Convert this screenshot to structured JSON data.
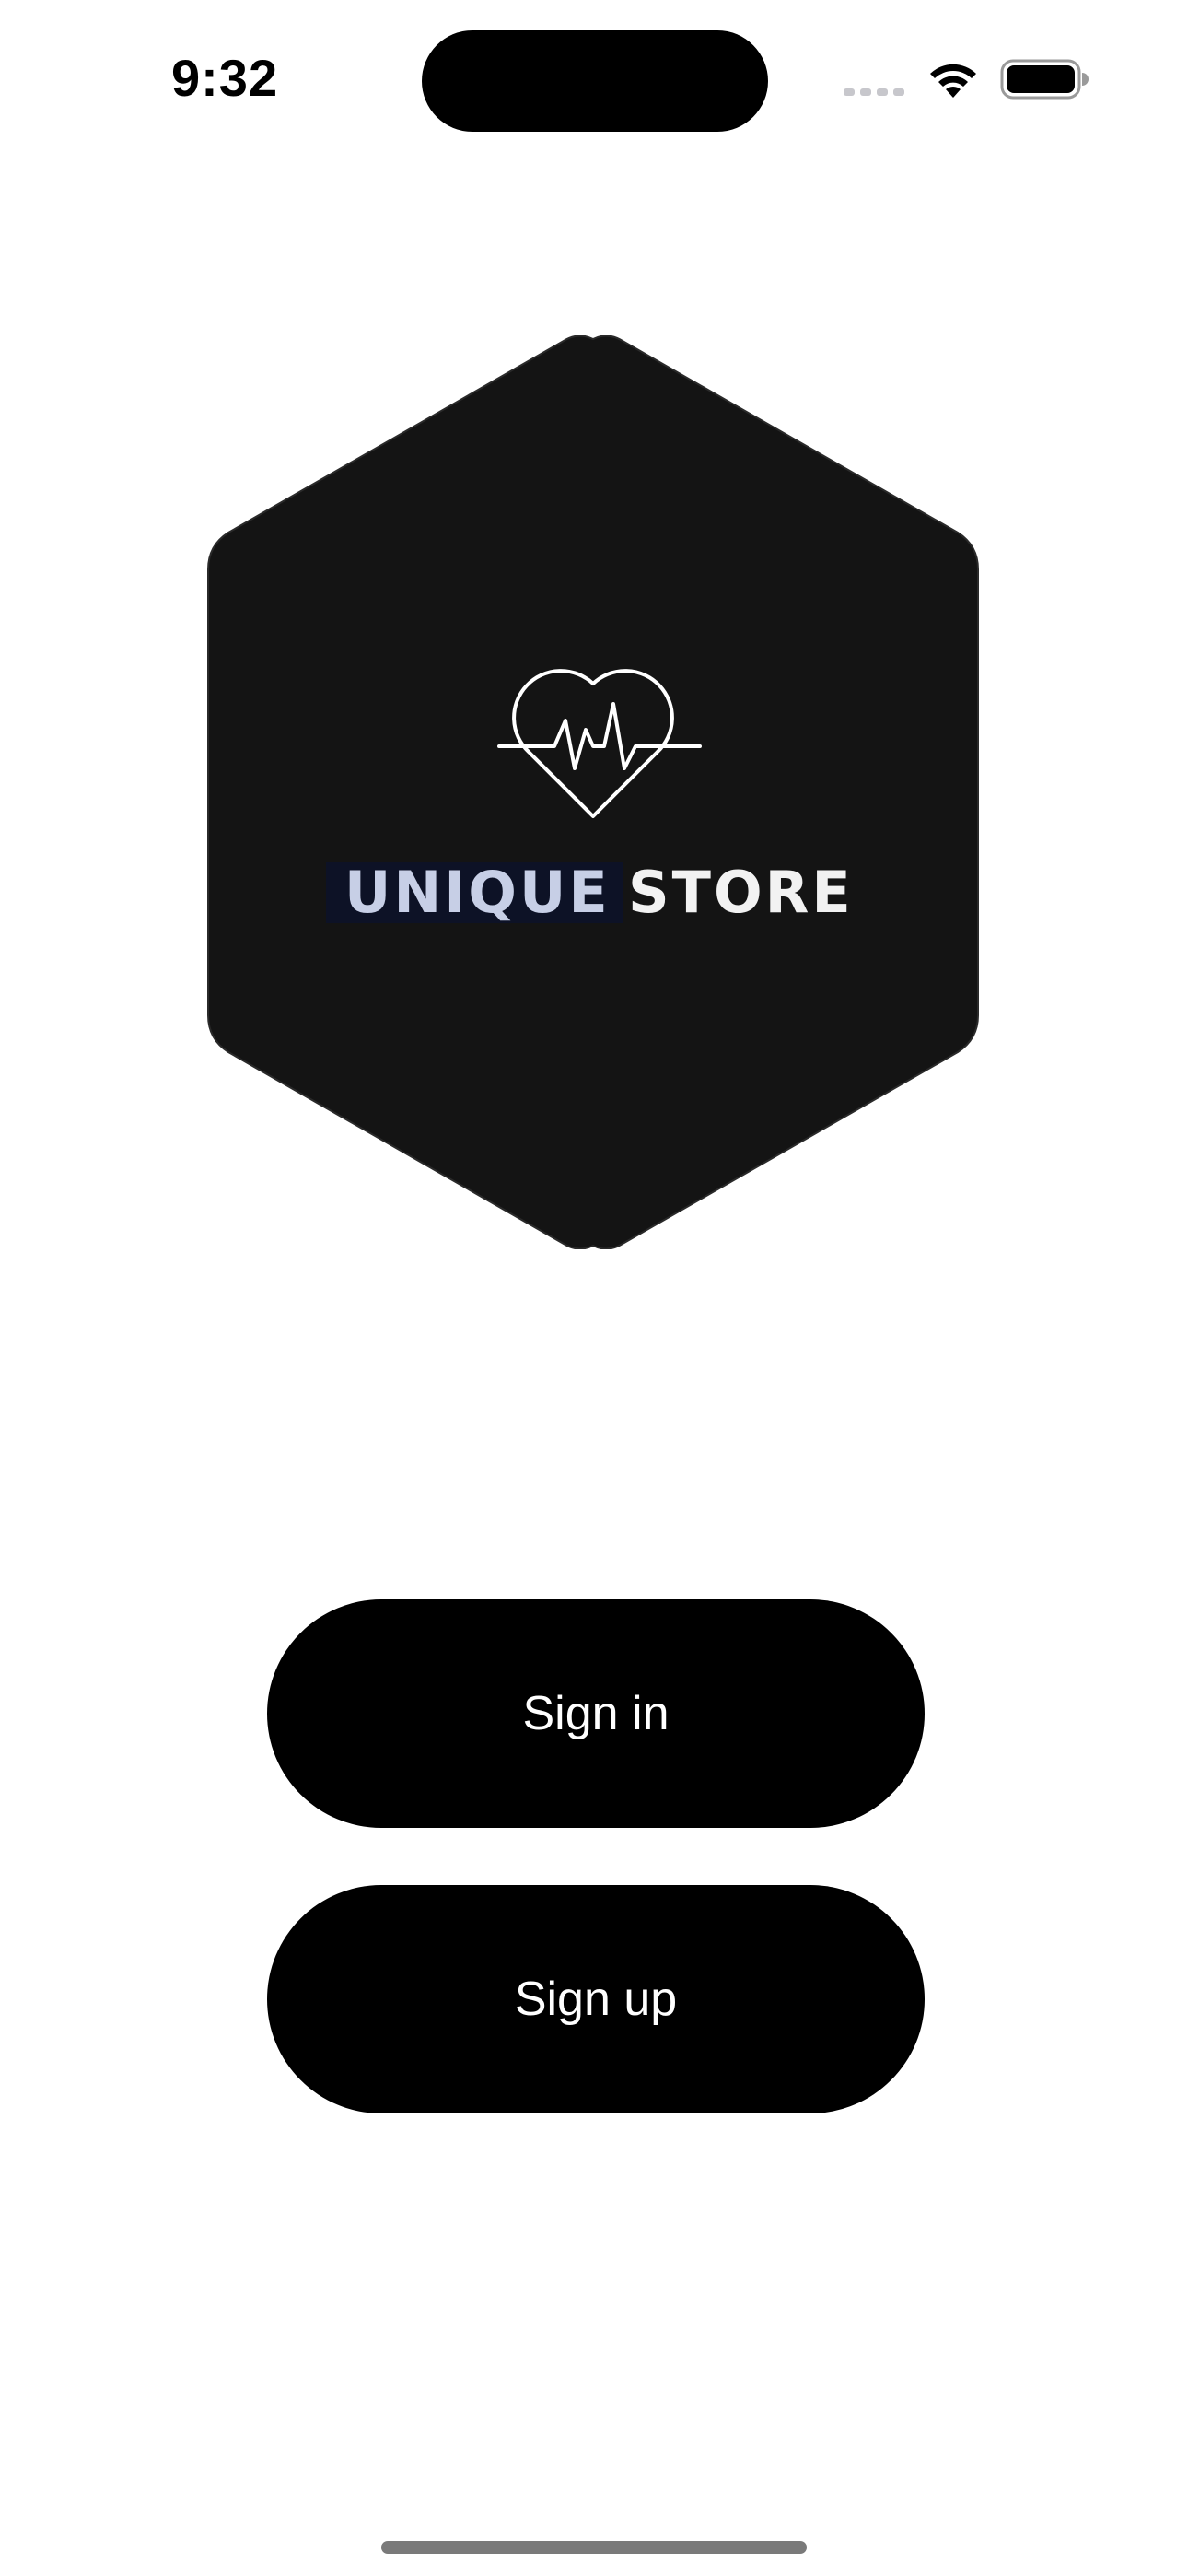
{
  "status_bar": {
    "time": "9:32",
    "icons": [
      "cellular-signal-icon",
      "wifi-icon",
      "battery-icon"
    ]
  },
  "logo": {
    "text_part1": "UNIQUE",
    "text_part2": "STORE",
    "icon": "heart-pulse-icon",
    "background_color": "#141414"
  },
  "actions": {
    "sign_in_label": "Sign in",
    "sign_up_label": "Sign up"
  },
  "colors": {
    "button_bg": "#000000",
    "button_text": "#ffffff",
    "page_bg": "#ffffff"
  }
}
